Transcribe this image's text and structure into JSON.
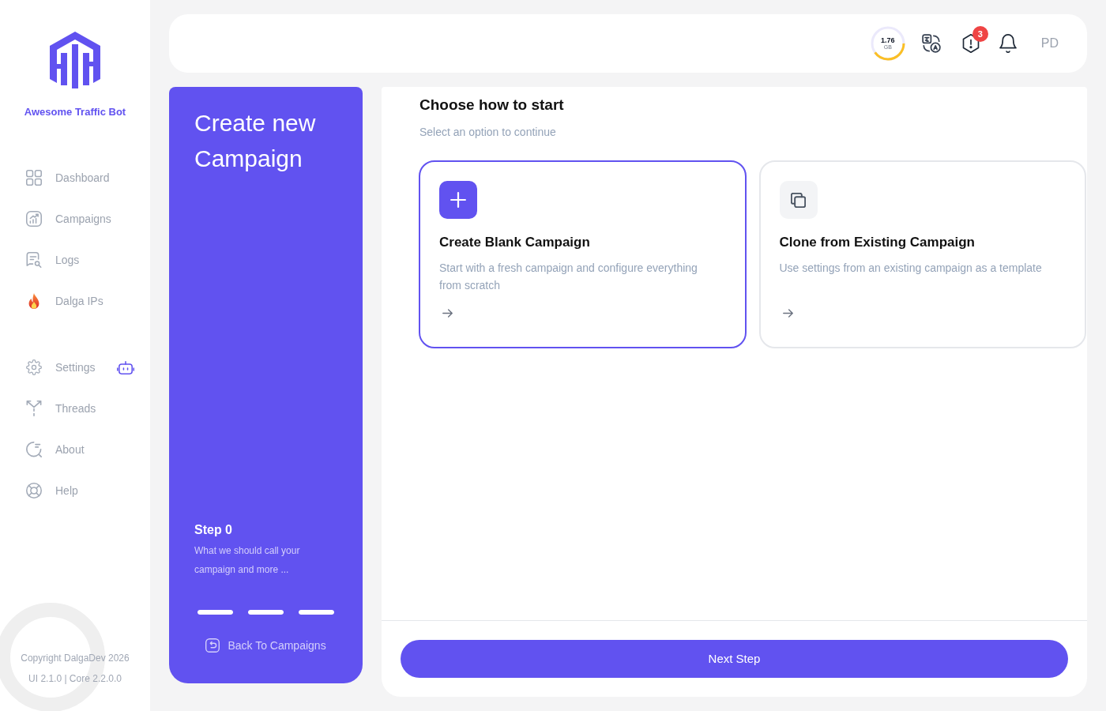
{
  "sidebar": {
    "brand": "Awesome Traffic Bot",
    "nav_groups": [
      {
        "items": [
          {
            "label": "Dashboard",
            "bot_icon": false
          },
          {
            "label": "Campaigns",
            "bot_icon": false
          },
          {
            "label": "Logs",
            "bot_icon": false
          },
          {
            "label": "Dalga IPs",
            "bot_icon": false
          }
        ]
      },
      {
        "items": [
          {
            "label": "Settings",
            "bot_icon": true
          },
          {
            "label": "Threads",
            "bot_icon": false
          },
          {
            "label": "About",
            "bot_icon": false
          },
          {
            "label": "Help",
            "bot_icon": false
          }
        ]
      }
    ],
    "footer": {
      "copyright": "Copyright DalgaDev 2026",
      "version": "UI 2.1.0 | Core 2.2.0.0"
    }
  },
  "topbar": {
    "storage": {
      "value": "1.76",
      "unit": "GB",
      "level": 0.4
    },
    "alerts_badge": "3",
    "user_initials": "PD"
  },
  "wizard": {
    "title": "Create new Campaign",
    "step_label": "Step 0",
    "step_description": "What we should call your campaign and more ...",
    "step_bars": [
      {
        "level": 1
      },
      {
        "level": 1
      },
      {
        "level": 1
      }
    ],
    "back_link": "Back To Campaigns"
  },
  "content": {
    "title": "Choose how to start",
    "subtitle": "Select an option to continue",
    "options": [
      {
        "kind": "blank",
        "title": "Create Blank Campaign",
        "description": "Start with a fresh campaign and configure everything from scratch",
        "selected": true
      },
      {
        "kind": "clone",
        "title": "Clone from Existing Campaign",
        "description": "Use settings from an existing campaign as a template",
        "selected": false
      }
    ]
  },
  "next_button": "Next Step"
}
